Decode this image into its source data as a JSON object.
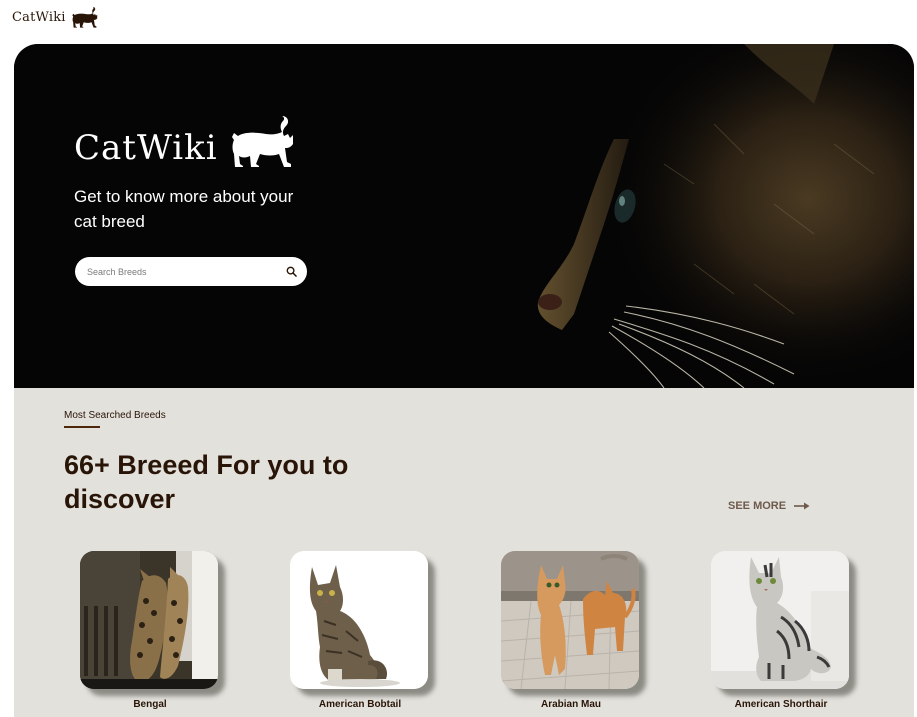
{
  "header": {
    "logo_text": "CatWiki"
  },
  "hero": {
    "brand_text": "CatWiki",
    "tagline": "Get to know more about your cat breed",
    "search": {
      "placeholder": "Search Breeds",
      "value": ""
    }
  },
  "breeds_section": {
    "label": "Most Searched Breeds",
    "heading": "66+ Breeed For you to discover",
    "see_more": "SEE MORE",
    "cards": [
      {
        "name": "Bengal"
      },
      {
        "name": "American Bobtail"
      },
      {
        "name": "Arabian Mau"
      },
      {
        "name": "American Shorthair"
      }
    ]
  },
  "colors": {
    "brand": "#291507",
    "section_bg": "#e3e1dc",
    "hero_bg": "#050505"
  },
  "icons": [
    "cat-silhouette-icon",
    "search-icon",
    "arrow-right-icon"
  ]
}
